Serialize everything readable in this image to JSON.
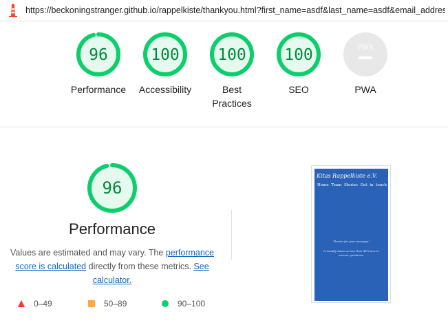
{
  "address_bar": {
    "url": "https://beckoningstranger.github.io/rappelkiste/thankyou.html?first_name=asdf&last_name=asdf&email_address=..."
  },
  "summary_gauges": [
    {
      "label": "Performance",
      "score": "96",
      "score_value": 96,
      "status": "pass"
    },
    {
      "label": "Accessibility",
      "score": "100",
      "score_value": 100,
      "status": "pass"
    },
    {
      "label": "Best\nPractices",
      "label_line1": "Best",
      "label_line2": "Practices",
      "score": "100",
      "score_value": 100,
      "status": "pass"
    },
    {
      "label": "SEO",
      "score": "100",
      "score_value": 100,
      "status": "pass"
    },
    {
      "label": "PWA",
      "badge": "PWA",
      "status": "na"
    }
  ],
  "performance_section": {
    "score": "96",
    "score_value": 96,
    "title": "Performance",
    "description_pre": "Values are estimated and may vary. The ",
    "description_link": "performance score is calculated",
    "description_mid": " directly from these metrics. ",
    "description_link2": "See calculator."
  },
  "legend": [
    {
      "range": "0–49",
      "shape": "triangle",
      "color": "#ff3333"
    },
    {
      "range": "50–89",
      "shape": "square",
      "color": "#ffaa33"
    },
    {
      "range": "90–100",
      "shape": "circle",
      "color": "#0cce6b"
    }
  ],
  "screenshot_thumbnail": {
    "brand": "Kitas Rappelkiste e.V.",
    "nav": [
      "Home",
      "Team",
      "Stories",
      "Get in touch"
    ],
    "message": "Thanks for your message!",
    "message2": "It usually takes us less than 48 hours to answer questions."
  },
  "colors": {
    "pass": "#0cce6b",
    "pass_text": "#008a3e",
    "pass_fill": "#e5f9ee",
    "na": "#cccccc",
    "link": "#1565c0",
    "thumb_bg": "#2a62b8"
  }
}
